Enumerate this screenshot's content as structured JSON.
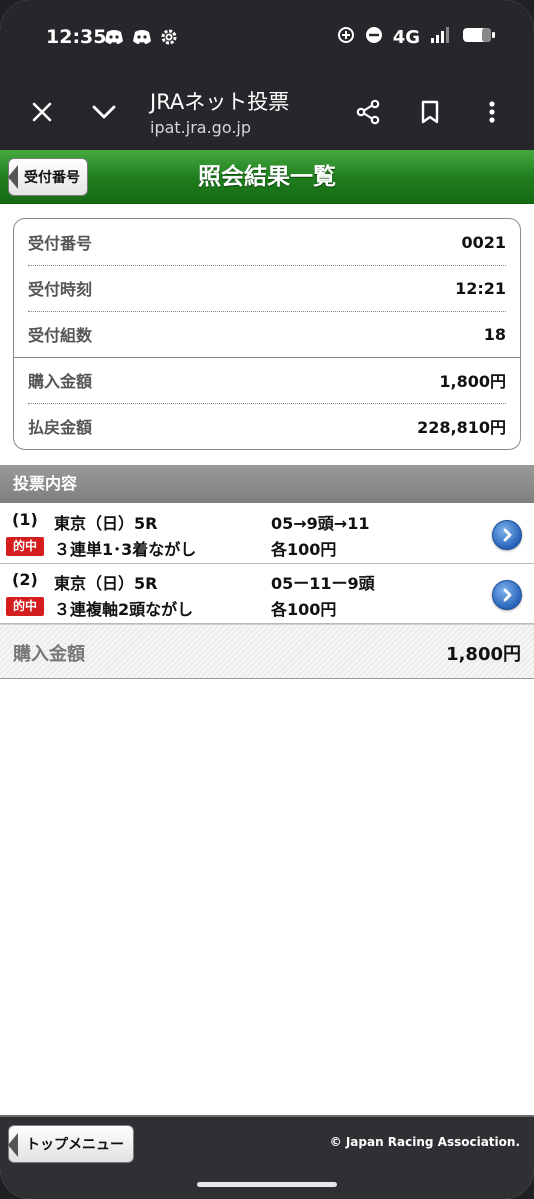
{
  "status_bar": {
    "time": "12:35",
    "network": "4G",
    "icons": [
      "discord-icon",
      "discord-icon",
      "gear-icon",
      "data-saver-icon",
      "do-not-disturb-icon",
      "signal-icon",
      "battery-icon"
    ]
  },
  "browser": {
    "title": "JRAネット投票",
    "url": "ipat.jra.go.jp",
    "icons": [
      "close-icon",
      "chevron-down-icon",
      "share-icon",
      "bookmark-icon",
      "more-vert-icon"
    ]
  },
  "header": {
    "back_label": "受付番号",
    "title": "照会結果一覧",
    "accent_color": "#1f7c1d"
  },
  "summary": {
    "rows": [
      {
        "label": "受付番号",
        "value": "0021"
      },
      {
        "label": "受付時刻",
        "value": "12:21"
      },
      {
        "label": "受付組数",
        "value": "18"
      },
      {
        "label": "購入金額",
        "value": "1,800円"
      },
      {
        "label": "払戻金額",
        "value": "228,810円"
      }
    ]
  },
  "bets": {
    "section_title": "投票内容",
    "hit_label": "的中",
    "hit_color": "#d41d1d",
    "items": [
      {
        "index": "(1)",
        "race": "東京（日）5R",
        "combo": "05→9頭→11",
        "type": "３連単1･3着ながし",
        "amount": "各100円"
      },
      {
        "index": "(2)",
        "race": "東京（日）5R",
        "combo": "05ー11ー9頭",
        "type": "３連複軸2頭ながし",
        "amount": "各100円"
      }
    ]
  },
  "total": {
    "label": "購入金額",
    "value": "1,800円"
  },
  "footer": {
    "top_menu_label": "トップメニュー",
    "copyright": "© Japan Racing Association."
  }
}
